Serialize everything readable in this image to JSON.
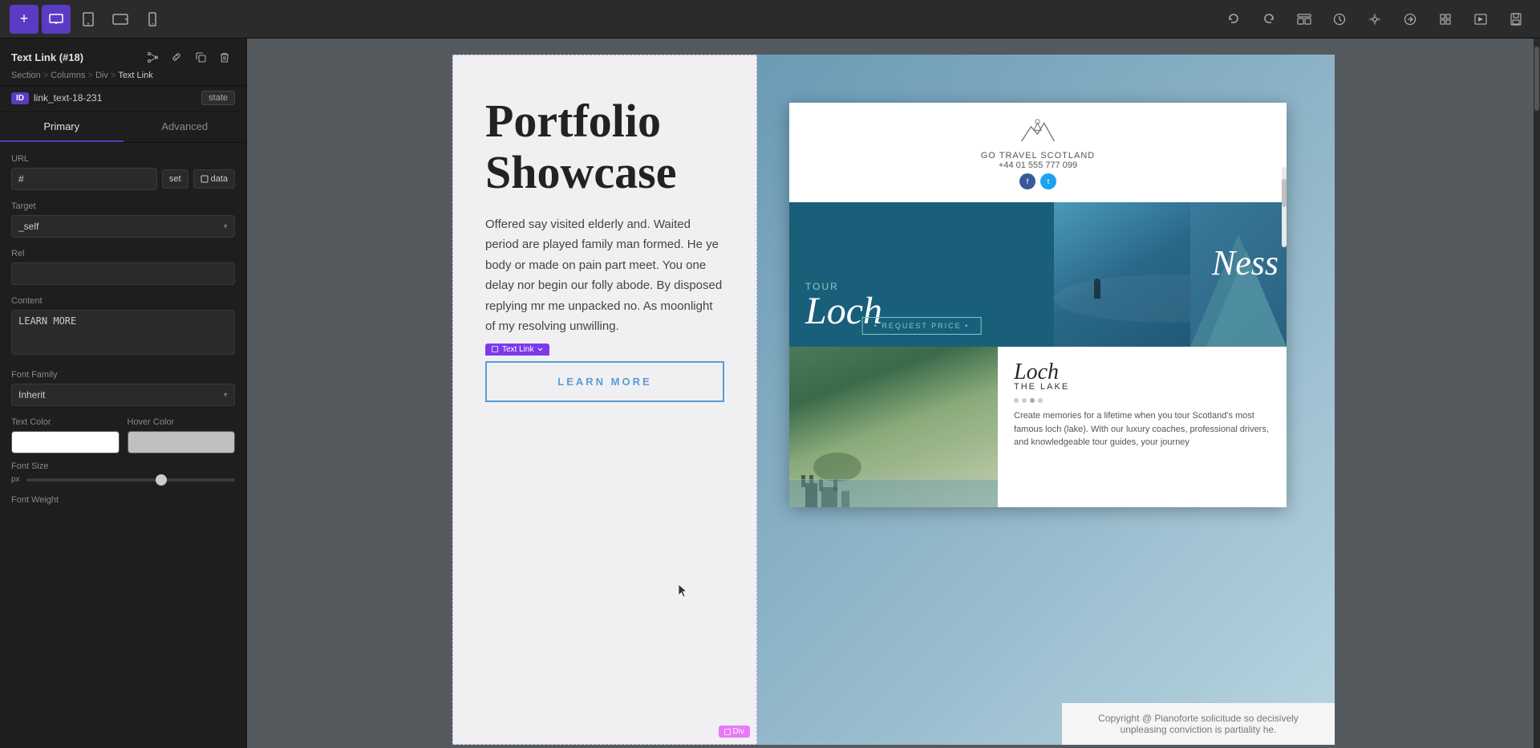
{
  "toolbar": {
    "add_icon": "+",
    "desktop_icon": "🖥",
    "tablet_icon": "⬜",
    "phone_icon": "📱",
    "undo_label": "↩",
    "redo_label": "↪",
    "align_icon": "⊟",
    "history_icon": "🕐",
    "settings_icon": "⚙",
    "responsive_icon": "◇",
    "grid_icon": "#",
    "preview_icon": "▷",
    "save_icon": "💾"
  },
  "sidebar": {
    "element_title": "Text Link (#18)",
    "breadcrumb": [
      "Section",
      "Columns",
      "Div",
      "Text Link"
    ],
    "breadcrumb_seps": [
      ">",
      ">",
      ">"
    ],
    "id_badge": "ID",
    "id_value": "link_text-18-231",
    "state_label": "state",
    "tab_primary": "Primary",
    "tab_advanced": "Advanced",
    "url_label": "URL",
    "url_value": "#",
    "set_btn": "set",
    "data_btn": "data",
    "target_label": "Target",
    "target_value": "_self",
    "rel_label": "Rel",
    "rel_value": "",
    "content_label": "Content",
    "content_value": "LEARN MORE",
    "font_family_label": "Font Family",
    "font_family_value": "Inherit",
    "text_color_label": "Text Color",
    "hover_color_label": "Hover Color",
    "font_size_label": "Font Size",
    "font_size_unit": "px",
    "font_weight_label": "Font Weight"
  },
  "canvas": {
    "portfolio_title": "Portfolio Showcase",
    "portfolio_desc": "Offered say visited elderly and. Waited period are played family man formed. He ye body or made on pain part meet. You one delay nor begin our folly abode. By disposed replying mr me unpacked no. As moonlight of my resolving unwilling.",
    "text_link_label": "Text Link",
    "learn_more_btn": "LEARN MORE",
    "div_badge": "Div",
    "travel": {
      "company_name": "GO TRAVEL SCOTLAND",
      "phone": "+44 01 555 777 099",
      "tour_text": "TOUR",
      "loch_text": "Loch",
      "ness_text": "Ness",
      "request_btn": "• REQUEST PRICE •",
      "loch_heading": "Loch",
      "the_lake": "THE LAKE",
      "travel_desc": "Create memories for a lifetime when you tour Scotland's most famous loch (lake). With our luxury coaches, professional drivers, and knowledgeable tour guides, your journey",
      "copyright": "Copyright @ Pianoforte solicitude so decisively unpleasing conviction is partiality he."
    }
  }
}
